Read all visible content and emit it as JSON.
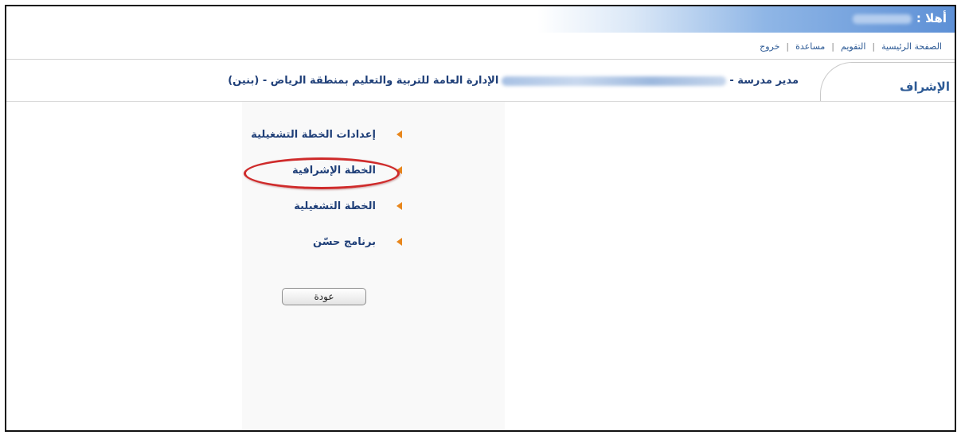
{
  "header": {
    "greeting": "أهلا :"
  },
  "nav": {
    "items": [
      {
        "label": "الصفحة الرئيسية"
      },
      {
        "label": "التقويم"
      },
      {
        "label": "مساعدة"
      },
      {
        "label": "خروج"
      }
    ],
    "separator": "|"
  },
  "section": {
    "tab_label": "الإشراف",
    "role_prefix": "مدير مدرسة -",
    "org_suffix": "الإدارة العامة للتربية والتعليم بمنطقة الرياض - (بنين)"
  },
  "menu": {
    "items": [
      {
        "label": "إعدادات الخطة التشغيلية"
      },
      {
        "label": "الخطة الإشرافية",
        "highlighted": true
      },
      {
        "label": "الخطة التشغيلية"
      },
      {
        "label": "برنامج حسّن"
      }
    ]
  },
  "actions": {
    "back_label": "عودة"
  },
  "colors": {
    "header_gradient": "#5d90d6",
    "link": "#1f3f78",
    "arrow": "#e8871d",
    "highlight_ring": "#cf2b2b"
  }
}
